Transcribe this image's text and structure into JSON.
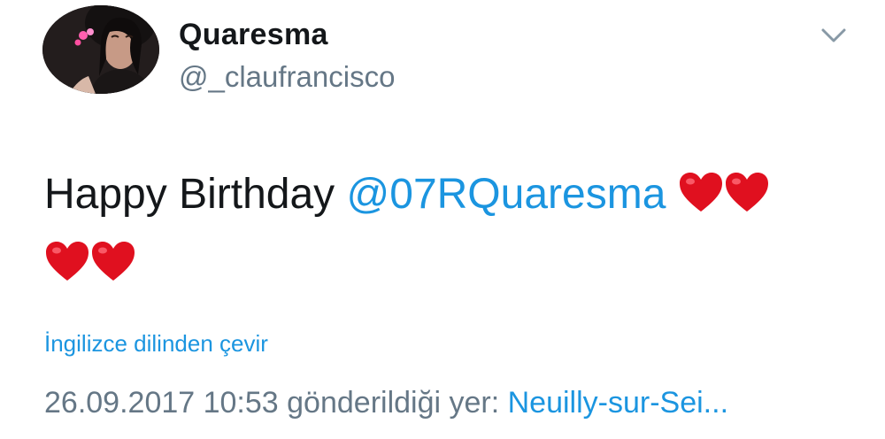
{
  "user": {
    "display_name": "Quaresma",
    "handle": "@_claufrancisco"
  },
  "header": {
    "menu_icon": "chevron-down-icon"
  },
  "tweet": {
    "text_prefix": "Happy Birthday ",
    "mention": "@07RQuaresma",
    "emoji_line1": [
      "red-heart-emoji",
      "red-heart-emoji"
    ],
    "emoji_line2": [
      "red-heart-emoji",
      "red-heart-emoji"
    ]
  },
  "translate": {
    "label": "İngilizce dilinden çevir"
  },
  "meta": {
    "datetime": "26.09.2017 10:53",
    "location_prefix": " gönderildiği yer: ",
    "location": "Neuilly-sur-Sei..."
  },
  "colors": {
    "link": "#1b95e0",
    "muted": "#657786",
    "text": "#14171a",
    "heart": "#e0101f"
  }
}
